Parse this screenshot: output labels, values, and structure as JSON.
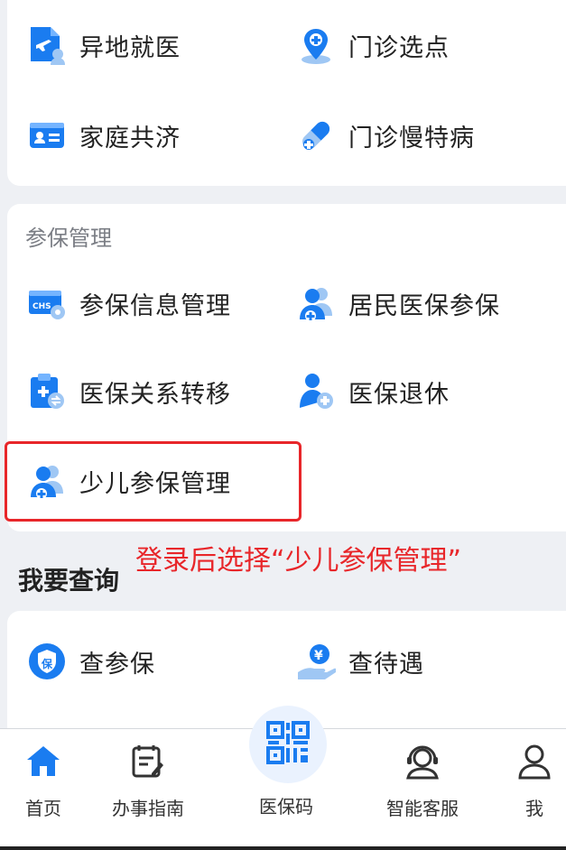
{
  "services": [
    {
      "label": "异地就医",
      "icon": "plane-doc-icon"
    },
    {
      "label": "门诊选点",
      "icon": "location-pin-icon"
    },
    {
      "label": "家庭共济",
      "icon": "id-card-icon"
    },
    {
      "label": "门诊慢特病",
      "icon": "pill-icon"
    }
  ],
  "insurance": {
    "title": "参保管理",
    "items": [
      {
        "label": "参保信息管理",
        "icon": "chs-card-gear-icon"
      },
      {
        "label": "居民医保参保",
        "icon": "users-plus-icon"
      },
      {
        "label": "医保关系转移",
        "icon": "clipboard-transfer-icon"
      },
      {
        "label": "医保退休",
        "icon": "person-retire-icon"
      },
      {
        "label": "少儿参保管理",
        "icon": "child-insurance-icon"
      }
    ]
  },
  "annotation": "登录后选择“少儿参保管理”",
  "query": {
    "title": "我要查询",
    "items": [
      {
        "label": "查参保",
        "icon": "shield-bao-icon"
      },
      {
        "label": "查待遇",
        "icon": "hand-coin-icon"
      }
    ],
    "shield_char": "保",
    "coin_char": "¥"
  },
  "chs_text": "CHS",
  "tabbar": [
    {
      "label": "首页",
      "icon": "home-icon"
    },
    {
      "label": "办事指南",
      "icon": "guide-icon"
    },
    {
      "label": "医保码",
      "icon": "qr-code-icon"
    },
    {
      "label": "智能客服",
      "icon": "headset-icon"
    },
    {
      "label": "我",
      "icon": "user-icon"
    }
  ],
  "colors": {
    "accent": "#1a7cf0",
    "highlight": "#e8262a"
  }
}
